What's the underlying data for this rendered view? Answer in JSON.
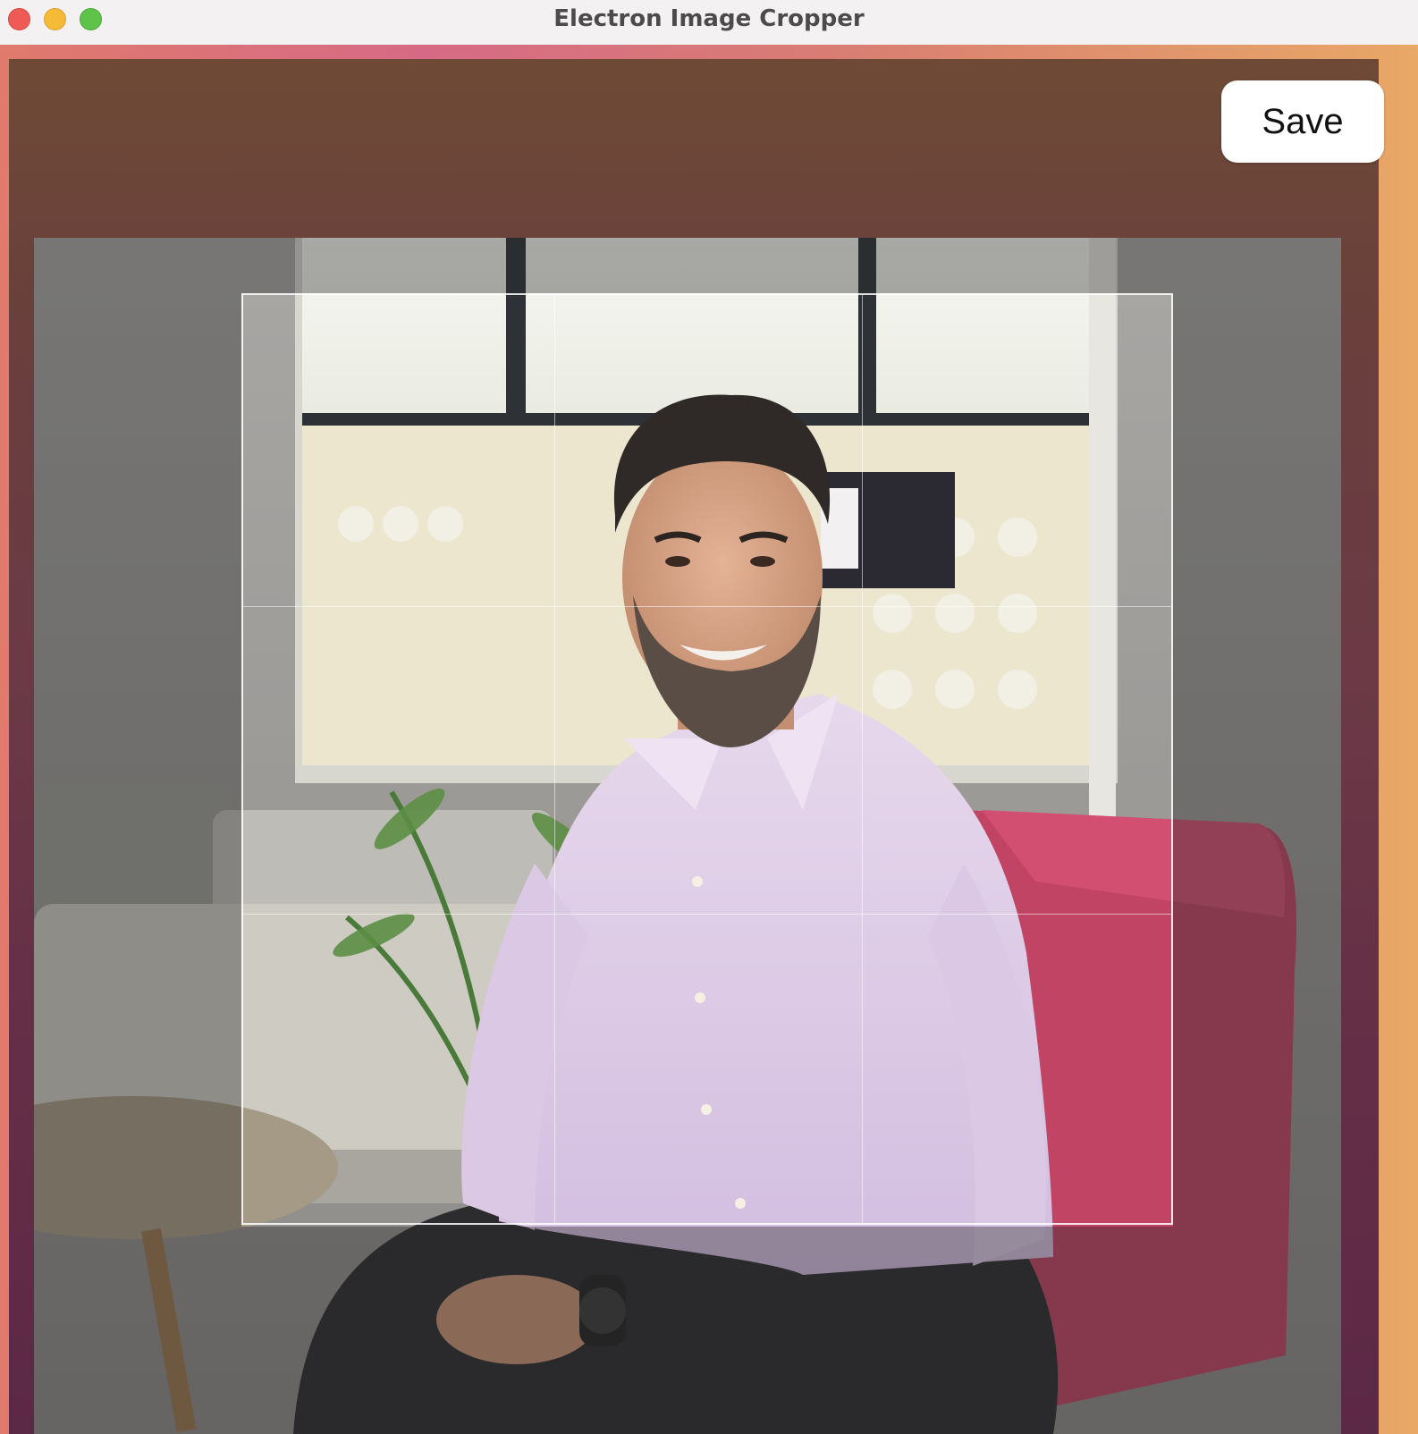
{
  "window": {
    "title": "Electron Image Cropper"
  },
  "toolbar": {
    "save_label": "Save"
  },
  "cropper": {
    "grid": "rule-of-thirds",
    "accent_color": "#ffffff"
  }
}
